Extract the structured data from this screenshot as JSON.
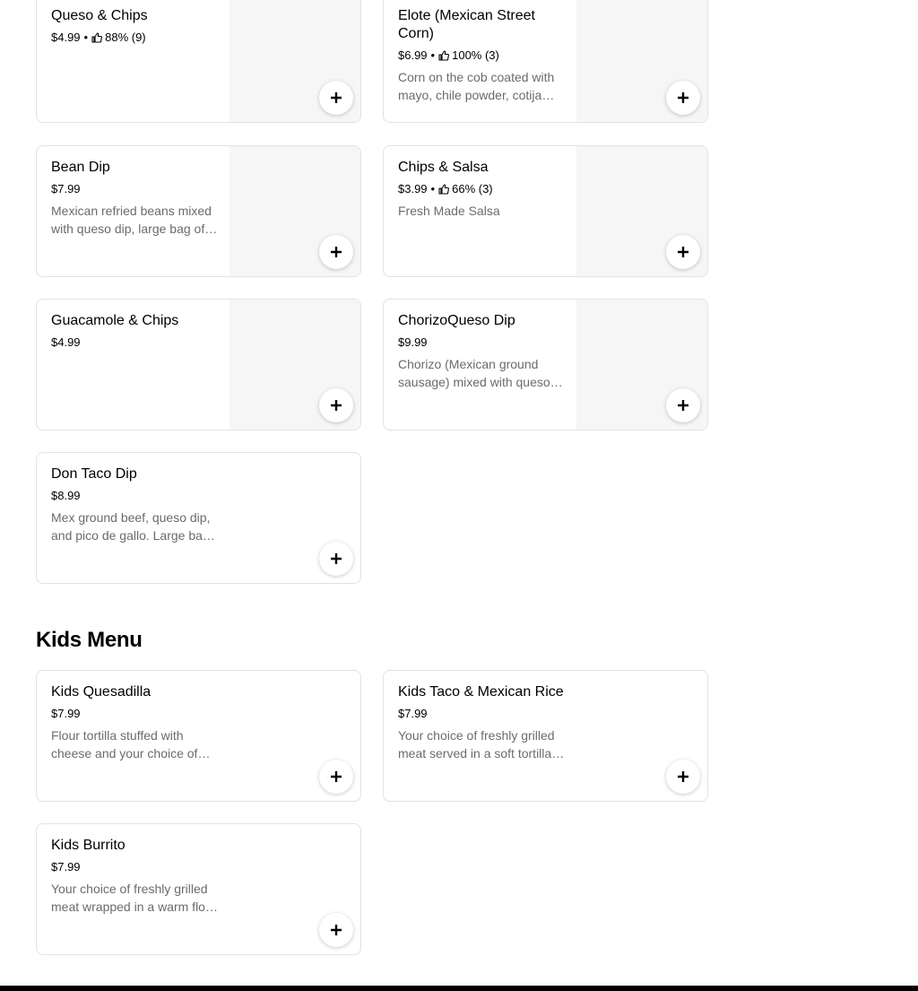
{
  "sections": {
    "kids_title": "Kids Menu"
  },
  "items": [
    {
      "name": "Queso & Chips",
      "price": "$4.99",
      "rating": "88% (9)",
      "desc": ""
    },
    {
      "name": "Elote (Mexican Street Corn)",
      "price": "$6.99",
      "rating": "100% (3)",
      "desc": "Corn on the cob coated with mayo, chile powder, cotija cheese and lime."
    },
    {
      "name": "Bean Dip",
      "price": "$7.99",
      "rating": "",
      "desc": "Mexican refried beans mixed with queso dip, large bag of chips."
    },
    {
      "name": "Chips & Salsa",
      "price": "$3.99",
      "rating": "66% (3)",
      "desc": "Fresh Made Salsa"
    },
    {
      "name": "Guacamole & Chips",
      "price": "$4.99",
      "rating": "",
      "desc": ""
    },
    {
      "name": "ChorizoQueso Dip",
      "price": "$9.99",
      "rating": "",
      "desc": "Chorizo (Mexican ground sausage) mixed with queso dip, large bag of chips."
    },
    {
      "name": "Don Taco Dip",
      "price": "$8.99",
      "rating": "",
      "desc": "Mex ground beef, queso dip, and pico de gallo. Large bag of chips."
    },
    {
      "name": "Kids Quesadilla",
      "price": "$7.99",
      "rating": "",
      "desc": "Flour tortilla stuffed with cheese and your choice of meat."
    },
    {
      "name": "Kids Taco & Mexican Rice",
      "price": "$7.99",
      "rating": "",
      "desc": "Your choice of freshly grilled meat served in a soft tortilla with Mexican rice."
    },
    {
      "name": "Kids Burrito",
      "price": "$7.99",
      "rating": "",
      "desc": "Your choice of freshly grilled meat wrapped in a warm flour tortilla."
    }
  ],
  "icons": {
    "add": "plus-icon",
    "rating": "thumbs-up-icon"
  },
  "colors": {
    "card_border": "#e2e2e2",
    "image_placeholder": "#f6f6f6",
    "desc_text": "#6b6b6b"
  }
}
